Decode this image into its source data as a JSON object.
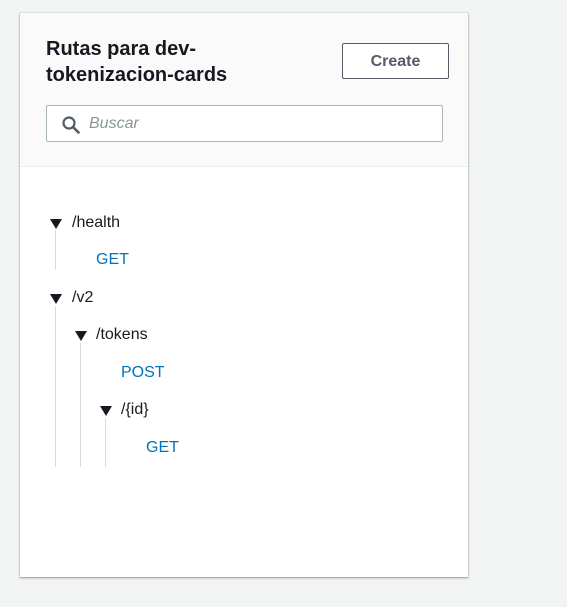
{
  "panel": {
    "title": "Rutas para dev-tokenizacion-cards",
    "create_label": "Create"
  },
  "search": {
    "placeholder": "Buscar",
    "icon": "search-icon"
  },
  "tree": {
    "health": {
      "path": "/health",
      "methods": [
        "GET"
      ]
    },
    "v2": {
      "path": "/v2",
      "tokens": {
        "path": "/tokens",
        "methods": [
          "POST"
        ],
        "id": {
          "path": "/{id}",
          "methods": [
            "GET"
          ]
        }
      }
    }
  },
  "colors": {
    "link": "#0073bb",
    "text": "#16191f",
    "button_border": "#545b64",
    "guide": "#d5dbdb",
    "background": "#f2f3f3"
  }
}
